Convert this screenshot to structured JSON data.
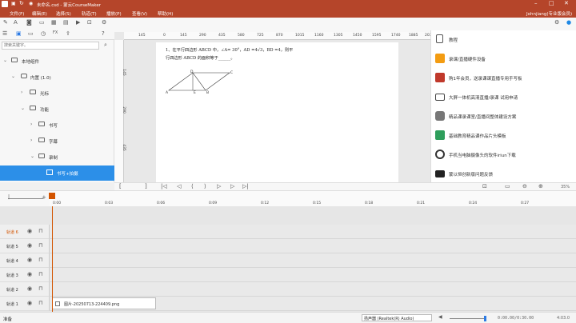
{
  "window": {
    "title": "未命名.csd - 蒙云CourseMaker",
    "user": "Johnjiang(专业版会员)"
  },
  "menu": [
    "文件(F)",
    "编辑(E)",
    "选择(S)",
    "轨道(T)",
    "播放(P)",
    "查看(V)",
    "帮助(H)"
  ],
  "search": {
    "placeholder": "搜索关键字。"
  },
  "tree": [
    {
      "label": "本地组件",
      "level": 0,
      "type": "folder"
    },
    {
      "label": "内置 (1.0)",
      "level": 1,
      "type": "pkg"
    },
    {
      "label": "光标",
      "level": 2,
      "type": "folder"
    },
    {
      "label": "功能",
      "level": 2,
      "type": "folder"
    },
    {
      "label": "书写",
      "level": 3,
      "type": "folder"
    },
    {
      "label": "字幕",
      "level": 3,
      "type": "folder"
    },
    {
      "label": "录制",
      "level": 3,
      "type": "folder"
    },
    {
      "label": "书写+拍摄",
      "level": 4,
      "type": "item",
      "selected": true
    }
  ],
  "ruler": [
    "145",
    "0",
    "145",
    "290",
    "435",
    "580",
    "725",
    "870",
    "1015",
    "1160",
    "1305",
    "1450",
    "1595",
    "1740",
    "1885",
    "2030"
  ],
  "vruler": [
    "145",
    "290",
    "435"
  ],
  "document": {
    "line1": "1、在平行四边形 ABCD 中，∠A= 30°，AD =4√3，BD =4，则平",
    "line2": "行四边形 ABCD 的面积等于______。",
    "labels": {
      "A": "A",
      "B": "B",
      "C": "C",
      "D": "D",
      "E": "E"
    }
  },
  "right_panel": [
    {
      "icon": "document-icon",
      "label": "教程",
      "color": "#555555"
    },
    {
      "icon": "cart-icon",
      "label": "录课/直播硬件设备",
      "color": "#e74c3c"
    },
    {
      "icon": "gift-icon",
      "label": "购1年会员，送录课课直播专用手写板",
      "color": "#c0392b"
    },
    {
      "icon": "display-icon",
      "label": "大屏一体机高清直播/录课 试用申请",
      "color": "#444444"
    },
    {
      "icon": "camera-icon",
      "label": "精品课录课室/直播间整体建设方案",
      "color": "#666666"
    },
    {
      "icon": "film-icon",
      "label": "基础教育精品课作品片头模板",
      "color": "#2e9e5b"
    },
    {
      "icon": "webcam-icon",
      "label": "手机当电脑摄像头的软件iriun下载",
      "color": "#333333"
    },
    {
      "icon": "mail-icon",
      "label": "蒙以恒创新版问题反馈",
      "color": "#222222"
    }
  ],
  "playbar": {
    "zoom": "35%"
  },
  "timeline": {
    "ticks": [
      "0:00",
      "0:03",
      "0:06",
      "0:09",
      "0:12",
      "0:15",
      "0:18",
      "0:21",
      "0:24",
      "0:27"
    ]
  },
  "tracks": [
    {
      "name": "轨道 6",
      "active": true
    },
    {
      "name": "轨道 5"
    },
    {
      "name": "轨道 4"
    },
    {
      "name": "轨道 3"
    },
    {
      "name": "轨道 2"
    },
    {
      "name": "轨道 1",
      "clip": "图片-20250713-224409.png"
    }
  ],
  "status": {
    "left": "准备",
    "audio_device": "扬声器 (Realtek(R) Audio)",
    "time": "0:00.00/0:30.00",
    "fps": "4:03.0"
  }
}
